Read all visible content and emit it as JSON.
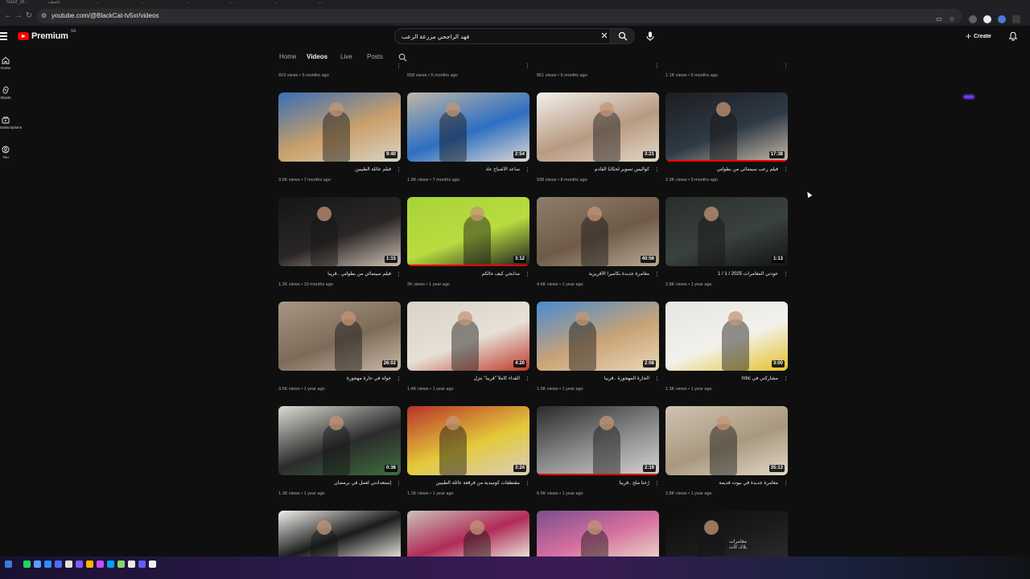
{
  "browser": {
    "url": "youtube.com/@BlackCat-tv5xr/videos",
    "tabs": [
      "Nasif_Bl...",
      "ناصف",
      "...",
      "...",
      "...",
      "...",
      "...",
      "..."
    ]
  },
  "header": {
    "logo_text": "Premium",
    "region": "SA",
    "search_query": "فهد الراجحي مزرعة الرعب",
    "create_label": "Create"
  },
  "sidebar": {
    "items": [
      {
        "label": "Home",
        "icon": "home-icon"
      },
      {
        "label": "Shorts",
        "icon": "shorts-icon"
      },
      {
        "label": "Subscriptions",
        "icon": "subscriptions-icon"
      },
      {
        "label": "You",
        "icon": "you-icon"
      }
    ]
  },
  "channel_tabs": [
    {
      "label": "Home",
      "active": false
    },
    {
      "label": "Videos",
      "active": true
    },
    {
      "label": "Live",
      "active": false
    },
    {
      "label": "Posts",
      "active": false
    }
  ],
  "partial_row": [
    {
      "meta": "919 views • 5 months ago"
    },
    {
      "meta": "558 views • 5 months ago"
    },
    {
      "meta": "851 views • 6 months ago"
    },
    {
      "meta": "1.1K views • 6 months ago"
    }
  ],
  "videos": [
    {
      "title": "فيلم عائلة الطيبين",
      "meta": "3.6K views • 7 months ago",
      "duration": "9:40",
      "palette": [
        "#3a6fb5",
        "#caa06a",
        "#d9d4c7"
      ],
      "progress": 0
    },
    {
      "title": "ساعد الأشباح عاد",
      "meta": "1.9K views • 7 months ago",
      "duration": "2:54",
      "palette": [
        "#bfb7a6",
        "#2d6fc2",
        "#dedad2"
      ],
      "progress": 0
    },
    {
      "title": "كواليس تصوير لحكايا القادم",
      "meta": "938 views • 8 months ago",
      "duration": "3:21",
      "palette": [
        "#f2f0ec",
        "#b89a82",
        "#e3d6c6"
      ],
      "progress": 0
    },
    {
      "title": "فيلم رعب سينمائي من بطولتي",
      "meta": "2.9K views • 9 months ago",
      "duration": "17:38",
      "palette": [
        "#1d1d20",
        "#2e3a46",
        "#c7b9a8"
      ],
      "progress": 1
    },
    {
      "title": "فيلم سينمائي من بطولتي ..قريباً",
      "meta": "1.2K views • 10 months ago",
      "duration": "1:15",
      "palette": [
        "#151515",
        "#2a2626",
        "#cfc1b3"
      ],
      "progress": 0
    },
    {
      "title": "مذابحي كيف حالكم",
      "meta": "2K views • 1 year ago",
      "duration": "3:12",
      "palette": [
        "#a7d33a",
        "#b9dc40",
        "#1e1e1e"
      ],
      "progress": 1
    },
    {
      "title": "مغامرة جديدة بكاميرا الأفريزية",
      "meta": "4.6K views • 1 year ago",
      "duration": "40:56",
      "palette": [
        "#8f7e6b",
        "#6f5a4a",
        "#b9a893"
      ],
      "progress": 0
    },
    {
      "title": "عودتي المغامرات 2025 / 1 / 1",
      "meta": "2.8K views • 1 year ago",
      "duration": "1:13",
      "palette": [
        "#2a2e2b",
        "#3a423d",
        "#121412"
      ],
      "progress": 0
    },
    {
      "title": "جولة في حارة مهجورة",
      "meta": "3.5K views • 1 year ago",
      "duration": "26:02",
      "palette": [
        "#a89684",
        "#7d6b5a",
        "#c8b8a4"
      ],
      "progress": 0
    },
    {
      "title": "القداء كاملاً \"قريباً\" بتزل",
      "meta": "1.4K views • 1 year ago",
      "duration": "4:20",
      "palette": [
        "#d8d2c8",
        "#e6e0d6",
        "#c0392b"
      ],
      "progress": 0
    },
    {
      "title": "الحارة المهجورة ..قريباً",
      "meta": "1.5K views • 1 year ago",
      "duration": "2:08",
      "palette": [
        "#4a8bd1",
        "#c9a376",
        "#ead7b8"
      ],
      "progress": 0
    },
    {
      "title": "مشاركتي في mbc",
      "meta": "1.3K views • 1 year ago",
      "duration": "3:00",
      "palette": [
        "#e7e5df",
        "#f3f1ec",
        "#e4c229"
      ],
      "progress": 0
    },
    {
      "title": "إستعدادتي لعمل في برمضان",
      "meta": "1.3K views • 1 year ago",
      "duration": "0:36",
      "palette": [
        "#dedbd4",
        "#2b2b2b",
        "#3e6e3e"
      ],
      "progress": 0
    },
    {
      "title": "مقتطفات كوميدية من فرقعة عائلة الطيبين",
      "meta": "1.1K views • 1 year ago",
      "duration": "3:24",
      "palette": [
        "#b8322a",
        "#e3c93a",
        "#d9cfc0"
      ],
      "progress": 0
    },
    {
      "title": "رُحنا ملح ..قريباً",
      "meta": "6.5K views • 1 year ago",
      "duration": "2:19",
      "palette": [
        "#2a2a2a",
        "#8c8d8f",
        "#d6d3cf"
      ],
      "progress": 1
    },
    {
      "title": "مغامرة جديدة في بيوت قديمة",
      "meta": "3.8K views • 1 year ago",
      "duration": "35:13",
      "palette": [
        "#cfc4b2",
        "#a8987f",
        "#e2d8c6"
      ],
      "progress": 0
    }
  ],
  "bottom_row": [
    {
      "palette": [
        "#f2f1ee",
        "#1b1b1b",
        "#dedcd6"
      ]
    },
    {
      "palette": [
        "#c9c2b8",
        "#b12b58",
        "#e7e0d4"
      ]
    },
    {
      "palette": [
        "#7a4e8c",
        "#d66fa0",
        "#e8d0c0"
      ]
    },
    {
      "palette": [
        "#0d0d0d",
        "#1a1a1a",
        "#2a2a2a"
      ],
      "overlay_text": "مغامرات بلاك كات"
    }
  ],
  "colors": {
    "background": "#0f0f0f",
    "accent": "#ff0000",
    "text_secondary": "#aaaaaa"
  }
}
